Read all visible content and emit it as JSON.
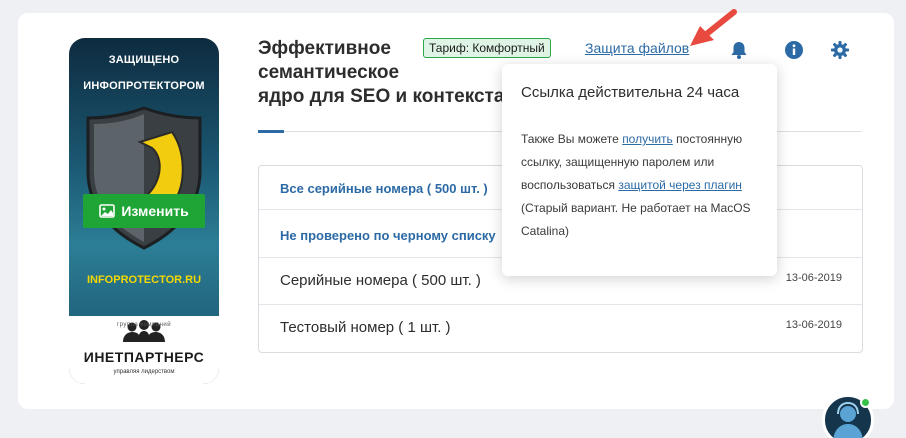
{
  "cover": {
    "top_line1": "ЗАЩИЩЕНО",
    "top_line2": "ИНФОПРОТЕКТОРОМ",
    "edit_label": "Изменить",
    "site": "INFOPROTECTOR.RU",
    "logo_small": "группа компаний",
    "logo_main": "ИНЕТПАРТНЕРС",
    "logo_sub": "управляя лидерством"
  },
  "product": {
    "title": "Эффективное семантическое ядро для SEO и контекста",
    "title_line1": "Эффективное",
    "title_line2": "семантическое",
    "title_line3": "ядро для SEO и контекста",
    "tariff": "Тариф: Комфортный",
    "protect_link": "Защита файлов"
  },
  "table": {
    "rows": [
      {
        "label": "Все серийные номера ( 500 шт. )",
        "date": ""
      },
      {
        "label": "Не проверено по черному списку",
        "date": ""
      },
      {
        "label": "Серийные номера ( 500 шт. )",
        "date": "13-06-2019"
      },
      {
        "label": "Тестовый номер ( 1 шт. )",
        "date": "13-06-2019"
      }
    ]
  },
  "popover": {
    "title": "Ссылка действительна 24 часа",
    "text1": "Также Вы можете ",
    "link1": "получить",
    "text2": " постоянную ссылку, защищенную паролем или воспользоваться ",
    "link2": "защитой через плагин",
    "text3": " (Старый вариант. Не работает на MacOS Catalina)"
  },
  "icons": [
    "bell-icon",
    "info-icon",
    "gear-icon",
    "image-icon",
    "arrow-icon"
  ],
  "colors": {
    "accent": "#2c6aa5",
    "green": "#1fa535",
    "yellow": "#f5d800",
    "red_arrow": "#e84a3f"
  }
}
